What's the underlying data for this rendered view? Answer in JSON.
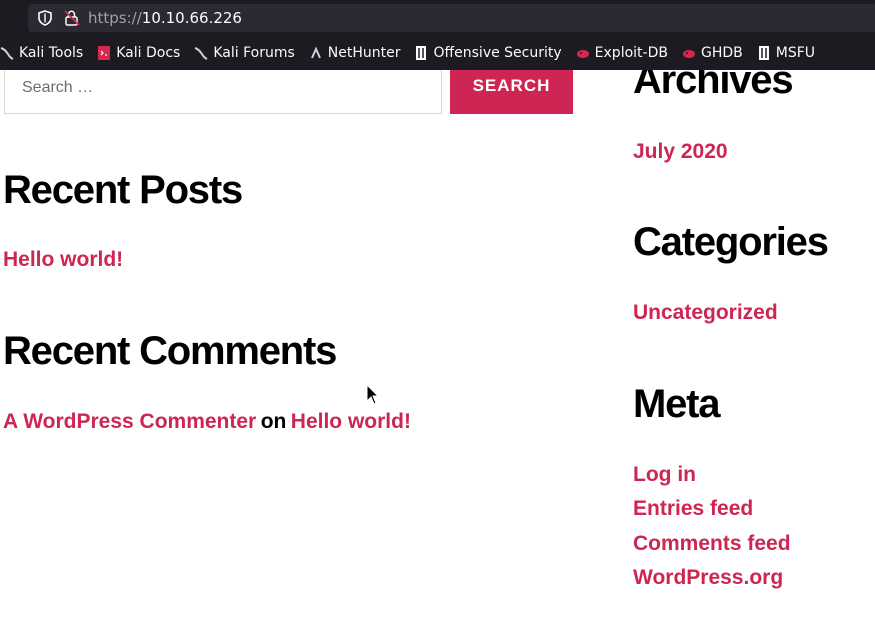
{
  "browser": {
    "url_scheme": "https://",
    "url_host": "10.10.66.226",
    "bookmarks": [
      {
        "label": "Kali Tools",
        "icon": "kali-dragon-icon"
      },
      {
        "label": "Kali Docs",
        "icon": "kali-docs-icon"
      },
      {
        "label": "Kali Forums",
        "icon": "kali-dragon-icon"
      },
      {
        "label": "NetHunter",
        "icon": "nethunter-icon"
      },
      {
        "label": "Offensive Security",
        "icon": "offsec-icon"
      },
      {
        "label": "Exploit-DB",
        "icon": "exploitdb-icon"
      },
      {
        "label": "GHDB",
        "icon": "exploitdb-icon"
      },
      {
        "label": "MSFU",
        "icon": "offsec-icon"
      }
    ]
  },
  "search": {
    "placeholder": "Search …",
    "button_label": "SEARCH"
  },
  "recent_posts": {
    "title": "Recent Posts",
    "items": [
      "Hello world!"
    ]
  },
  "recent_comments": {
    "title": "Recent Comments",
    "author": "A WordPress Commenter",
    "connector": "on",
    "post": "Hello world!"
  },
  "archives": {
    "title": "Archives",
    "items": [
      "July 2020"
    ]
  },
  "categories": {
    "title": "Categories",
    "items": [
      "Uncategorized"
    ]
  },
  "meta": {
    "title": "Meta",
    "items": [
      "Log in",
      "Entries feed",
      "Comments feed",
      "WordPress.org"
    ]
  },
  "colors": {
    "accent": "#cd2653",
    "chrome_bg": "#1c1b22",
    "urlbar_bg": "#2b2a33"
  }
}
